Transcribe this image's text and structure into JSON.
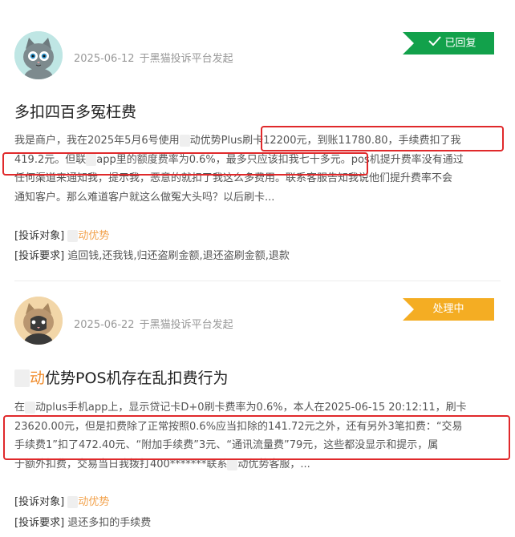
{
  "complaints": [
    {
      "date": "2025-06-12",
      "platform": "于黑猫投诉平台发起",
      "status": "已回复",
      "title": "多扣四百多冤枉费",
      "body": {
        "l1a": "我是商户，我在2025年5月6号使用",
        "l1mask": "联",
        "l1b": "动优势Plus刷卡12200元，到账11780.80，手续费扣了我",
        "l2a": "419.2元。但联",
        "l2mask": "动",
        "l2b": "app里的额度费率为0.6%，最多只应该扣我七十多元。pos机提升费率没有通过",
        "l3": "任何渠道来通知我，提示我，恶意的就扣了我这么多费用。联系客服告知我说他们提升费率不会",
        "l4": "通知客户。那么难道客户就这么做冤大头吗？以后刷卡..."
      },
      "target_label": "[投诉对象]",
      "target_mask": "联",
      "target_value": "动优势",
      "demand_label": "[投诉要求]",
      "demand_value": "追回钱,还我钱,归还盗刷金额,退还盗刷金额,退款"
    },
    {
      "date": "2025-06-22",
      "platform": "于黑猫投诉平台发起",
      "status": "处理中",
      "title_mask": "联",
      "title_brand": "动",
      "title_rest": "优势POS机存在乱扣费行为",
      "body": {
        "l1a": "在",
        "l1mask": "联",
        "l1b": "动plus手机app上，显示贷记卡D+0刷卡费率为0.6%，本人在2025-06-15 20:12:11，刷卡",
        "l2": "23620.00元，但是扣费除了正常按照0.6%应当扣除的141.72元之外，还有另外3笔扣费：“交易",
        "l3": "手续费1”扣了472.40元、“附加手续费”3元、“通讯流量费”79元，这些都没显示和提示，属",
        "l4a": "于额外扣费，交易当日我拨打400*******联系",
        "l4mask": "联",
        "l4b": "动优势客服，..."
      },
      "target_label": "[投诉对象]",
      "target_mask": "联",
      "target_value": "动优势",
      "demand_label": "[投诉要求]",
      "demand_value": "退还多扣的手续费"
    }
  ],
  "colors": {
    "replied": "#12a14b",
    "processing": "#f4ad23",
    "highlight": "#e0292b",
    "brand": "#f08c2c"
  },
  "icons": {
    "avatar": "cat-avatar-icon",
    "status_check": "check-icon"
  }
}
